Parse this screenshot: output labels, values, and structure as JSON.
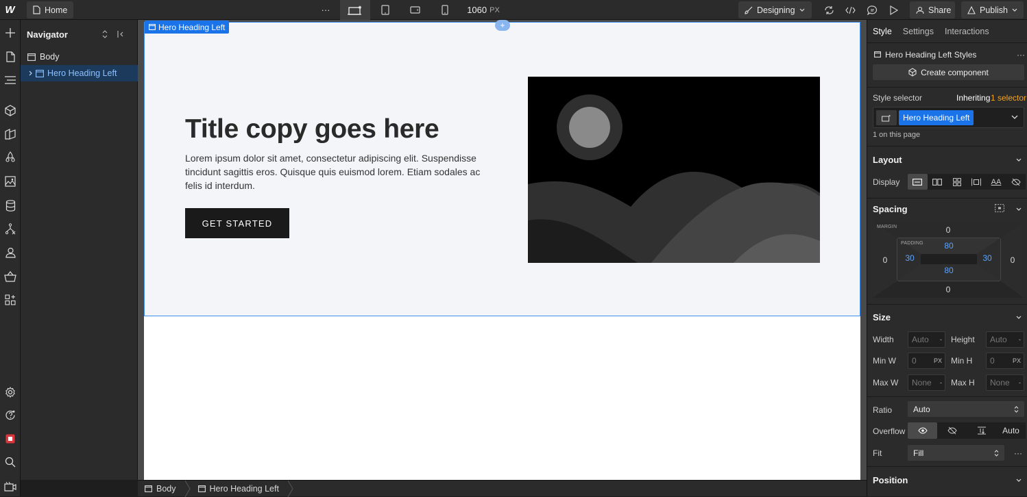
{
  "topbar": {
    "logo": "W",
    "home_label": "Home",
    "more_label": "···",
    "width_value": "1060",
    "width_unit": "PX",
    "mode_label": "Designing",
    "share_label": "Share",
    "publish_label": "Publish"
  },
  "navigator": {
    "title": "Navigator",
    "items": [
      {
        "label": "Body"
      },
      {
        "label": "Hero Heading Left"
      }
    ]
  },
  "canvas": {
    "tag_label": "Hero Heading Left",
    "handle_label": "+",
    "hero": {
      "title": "Title copy goes here",
      "body": "Lorem ipsum dolor sit amet, consectetur adipiscing elit. Suspendisse tincidunt sagittis eros. Quisque quis euismod lorem. Etiam sodales ac felis id interdum.",
      "button_label": "GET STARTED"
    }
  },
  "breadcrumb": {
    "items": [
      {
        "label": "Body"
      },
      {
        "label": "Hero Heading Left"
      }
    ]
  },
  "right_panel": {
    "tabs": [
      {
        "label": "Style"
      },
      {
        "label": "Settings"
      },
      {
        "label": "Interactions"
      }
    ],
    "styles_title": "Hero Heading Left Styles",
    "more_label": "···",
    "create_component_label": "Create component",
    "style_selector_label": "Style selector",
    "inheriting_label": "Inheriting",
    "inheriting_count": "1 selector",
    "selector_chip": "Hero Heading Left",
    "on_page_label": "1 on this page",
    "layout": {
      "title": "Layout",
      "display_label": "Display",
      "text_option": "AA"
    },
    "spacing": {
      "title": "Spacing",
      "margin_label": "MARGIN",
      "padding_label": "PADDING",
      "margin_top": "0",
      "margin_right": "0",
      "margin_bottom": "0",
      "margin_left": "0",
      "padding_top": "80",
      "padding_right": "30",
      "padding_bottom": "80",
      "padding_left": "30"
    },
    "size": {
      "title": "Size",
      "width_label": "Width",
      "height_label": "Height",
      "minw_label": "Min W",
      "minh_label": "Min H",
      "maxw_label": "Max W",
      "maxh_label": "Max H",
      "width_value": "Auto",
      "height_value": "Auto",
      "minw_value": "0",
      "minh_value": "0",
      "maxw_value": "None",
      "maxh_value": "None",
      "unit_px": "PX",
      "unit_dash": "-",
      "ratio_label": "Ratio",
      "ratio_value": "Auto",
      "overflow_label": "Overflow",
      "overflow_auto": "Auto",
      "fit_label": "Fit",
      "fit_value": "Fill"
    },
    "position": {
      "title": "Position"
    }
  },
  "colors": {
    "accent_blue": "#1a73e8",
    "selection_outline": "#3b8ef0",
    "highlight_orange": "#f5a623",
    "panel_bg": "#2b2b2b",
    "hero_bg": "#f4f5f9"
  }
}
